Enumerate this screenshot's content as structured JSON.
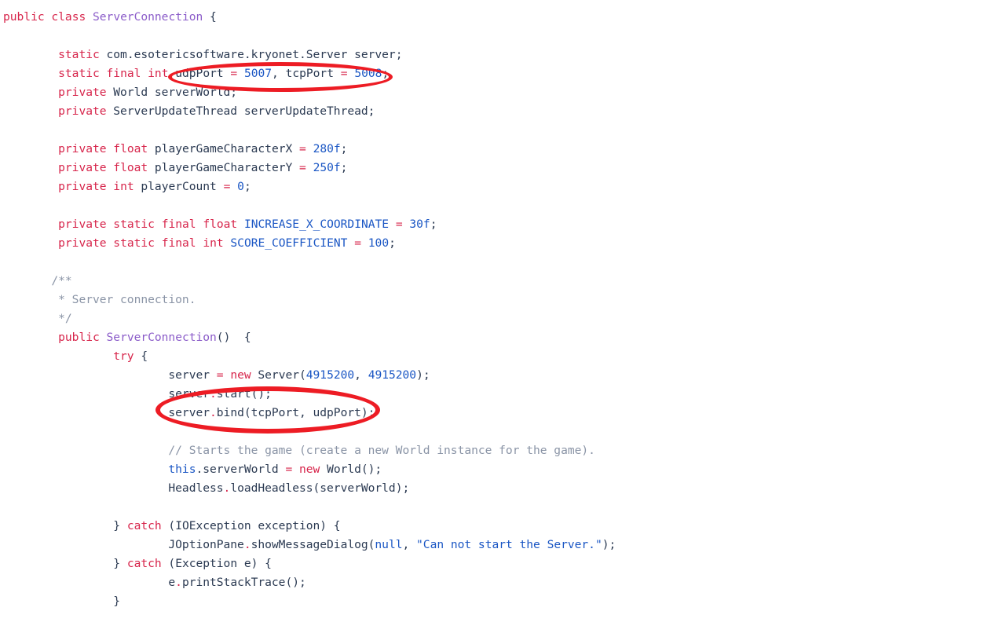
{
  "editor": {
    "language": "java",
    "background_color": "#ffffff",
    "font_size_px": 14.6,
    "line_height_px": 24
  },
  "theme": {
    "keyword_color": "#d7254b",
    "type_color": "#8b5cc9",
    "literal_color": "#1a56c4",
    "identifier_color": "#2b3a52",
    "comment_color": "#8a94a6",
    "annotation_color": "#ed1c24"
  },
  "code": {
    "lines": [
      "public class ServerConnection {",
      "",
      "        static com.esotericsoftware.kryonet.Server server;",
      "        static final int udpPort = 5007, tcpPort = 5008;",
      "        private World serverWorld;",
      "        private ServerUpdateThread serverUpdateThread;",
      "",
      "        private float playerGameCharacterX = 280f;",
      "        private float playerGameCharacterY = 250f;",
      "        private int playerCount = 0;",
      "",
      "        private static final float INCREASE_X_COORDINATE = 30f;",
      "        private static final int SCORE_COEFFICIENT = 100;",
      "",
      "        /**",
      "         * Server connection.",
      "         */",
      "        public ServerConnection()  {",
      "                try {",
      "                        server = new Server(4915200, 4915200);",
      "                        server.start();",
      "                        server.bind(tcpPort, udpPort);",
      "",
      "                        // Starts the game (create a new World instance for the game).",
      "                        this.serverWorld = new World();",
      "                        Headless.loadHeadless(serverWorld);",
      "",
      "                } catch (IOException exception) {",
      "                        JOptionPane.showMessageDialog(null, \"Can not start the Server.\");",
      "                } catch (Exception e) {",
      "                        e.printStackTrace();",
      "                }"
    ],
    "tokens": {
      "l1": {
        "kw_public": "public",
        "kw_class": "class",
        "type_name": "ServerConnection",
        "brace": " {"
      },
      "l3": {
        "kw_static": "static",
        "fq_type": " com.esotericsoftware.kryonet.Server server;"
      },
      "l4": {
        "kw_static": "static",
        "kw_final": "final",
        "kw_int": "int",
        "name_udp": "udpPort",
        "eq1": "=",
        "val_udp": "5007",
        "comma": ", ",
        "name_tcp": "tcpPort",
        "eq2": "=",
        "val_tcp": "5008",
        "semi": ";"
      },
      "l5": {
        "kw_private": "private",
        "rest": " World serverWorld;"
      },
      "l6": {
        "kw_private": "private",
        "rest": " ServerUpdateThread serverUpdateThread;"
      },
      "l8": {
        "kw_private": "private",
        "kw_float": "float",
        "name": "playerGameCharacterX",
        "eq": "=",
        "val": "280f",
        "semi": ";"
      },
      "l9": {
        "kw_private": "private",
        "kw_float": "float",
        "name": "playerGameCharacterY",
        "eq": "=",
        "val": "250f",
        "semi": ";"
      },
      "l10": {
        "kw_private": "private",
        "kw_int": "int",
        "name": "playerCount",
        "eq": "=",
        "val": "0",
        "semi": ";"
      },
      "l12": {
        "kw_private": "private",
        "kw_static": "static",
        "kw_final": "final",
        "kw_float": "float",
        "name": "INCREASE_X_COORDINATE",
        "eq": "=",
        "val": "30f",
        "semi": ";"
      },
      "l13": {
        "kw_private": "private",
        "kw_static": "static",
        "kw_final": "final",
        "kw_int": "int",
        "name": "SCORE_COEFFICIENT",
        "eq": "=",
        "val": "100",
        "semi": ";"
      },
      "l15": {
        "comment": "/**"
      },
      "l16": {
        "comment": " * Server connection."
      },
      "l17": {
        "comment": " */"
      },
      "l18": {
        "kw_public": "public",
        "ctor": "ServerConnection",
        "rest": "()  {"
      },
      "l19": {
        "kw_try": "try",
        "brace": " {"
      },
      "l20": {
        "lhs": "server ",
        "eq": "=",
        "kw_new": " new ",
        "rhs_open": "Server(",
        "a1": "4915200",
        "comma": ", ",
        "a2": "4915200",
        "close": ");"
      },
      "l21": {
        "text": "server",
        "dot": ".",
        "call": "start();"
      },
      "l22": {
        "text": "server",
        "dot": ".",
        "call": "bind(tcpPort, udpPort);"
      },
      "l24": {
        "comment": "// Starts the game (create a new World instance for the game)."
      },
      "l25": {
        "kw_this": "this",
        "mid": ".serverWorld ",
        "eq": "=",
        "kw_new": " new ",
        "rhs": "World();"
      },
      "l26": {
        "obj": "Headless",
        "dot": ".",
        "call": "loadHeadless(serverWorld);"
      },
      "l28": {
        "close_brace": "} ",
        "kw_catch": "catch",
        "rest": " (IOException exception) {"
      },
      "l29": {
        "pre": "JOptionPane",
        "dot": ".",
        "call_open": "showMessageDialog(",
        "null_lit": "null",
        "comma": ", ",
        "string_lit": "\"Can not start the Server.\"",
        "close": ");"
      },
      "l30": {
        "close_brace": "} ",
        "kw_catch": "catch",
        "rest": " (Exception e) {"
      },
      "l31": {
        "text": "e",
        "dot": ".",
        "call": "printStackTrace();"
      },
      "l32": {
        "close_brace": "}"
      }
    }
  },
  "annotations": [
    {
      "id": "annot-ports",
      "shape": "ellipse",
      "color": "#ed1c24",
      "encircles": "udpPort = 5007, tcpPort = 5008;"
    },
    {
      "id": "annot-start-bind",
      "shape": "ellipse",
      "color": "#ed1c24",
      "encircles": "server.start(); server.bind(tcpPort, udpPort);"
    }
  ]
}
